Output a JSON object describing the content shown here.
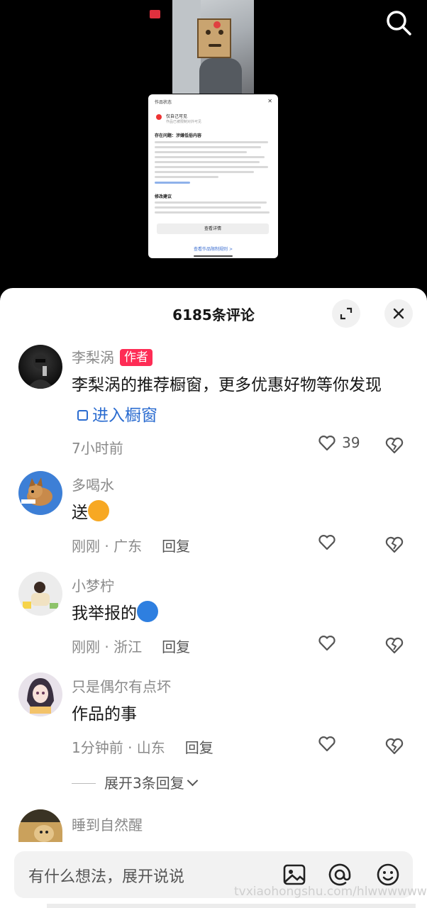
{
  "video": {
    "popup": {
      "title": "作品状态",
      "status": "仅自己可见",
      "status_sub": "作品已被限制对外可见",
      "issue_heading": "存在问题：涉嫌低俗内容",
      "advice_heading": "修改建议",
      "view_details": "查看详情",
      "link": "查看作品限制规则 >"
    }
  },
  "panel": {
    "title": "6185条评论"
  },
  "comments": [
    {
      "username": "李梨涡",
      "badge": "作者",
      "text": "李梨涡的推荐橱窗，更多优惠好物等你发现",
      "link_text": "进入橱窗",
      "meta": "7小时前",
      "likes": "39"
    },
    {
      "username": "多喝水",
      "text": "送",
      "meta": "刚刚 · 广东",
      "reply": "回复"
    },
    {
      "username": "小梦柠",
      "text": "我举报的",
      "meta": "刚刚 · 浙江",
      "reply": "回复"
    },
    {
      "username": "只是偶尔有点坏",
      "text": "作品的事",
      "meta": "1分钟前 · 山东",
      "reply": "回复",
      "expand": "展开3条回复"
    },
    {
      "username": "睡到自然醒"
    }
  ],
  "input": {
    "placeholder": "有什么想法，展开说说"
  },
  "watermark": "tvxiaohongshu.com/hlwwwwww",
  "colors": {
    "accent": "#fe2c55",
    "link": "#2b6cd0"
  },
  "icons": [
    "search-icon",
    "expand-icon",
    "close-icon",
    "heart-icon",
    "dislike-icon",
    "image-icon",
    "at-icon",
    "emoji-icon"
  ]
}
